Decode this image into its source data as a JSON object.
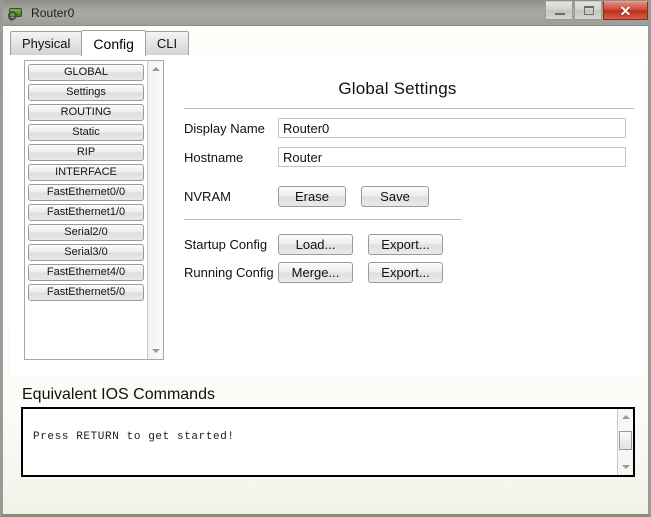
{
  "window": {
    "title": "Router0",
    "icon": "router-magnifier-icon",
    "controls": {
      "minimize_label": "",
      "maximize_label": "",
      "close_label": "✕"
    }
  },
  "tabs": [
    {
      "label": "Physical",
      "active": false
    },
    {
      "label": "Config",
      "active": true
    },
    {
      "label": "CLI",
      "active": false
    }
  ],
  "sidebar": {
    "items": [
      {
        "label": "GLOBAL"
      },
      {
        "label": "Settings"
      },
      {
        "label": "ROUTING"
      },
      {
        "label": "Static"
      },
      {
        "label": "RIP"
      },
      {
        "label": "INTERFACE"
      },
      {
        "label": "FastEthernet0/0"
      },
      {
        "label": "FastEthernet1/0"
      },
      {
        "label": "Serial2/0"
      },
      {
        "label": "Serial3/0"
      },
      {
        "label": "FastEthernet4/0"
      },
      {
        "label": "FastEthernet5/0"
      }
    ],
    "scroll_up_icon": "triangle-up-icon",
    "scroll_down_icon": "triangle-down-icon"
  },
  "settings": {
    "title": "Global Settings",
    "display_name": {
      "label": "Display Name",
      "value": "Router0"
    },
    "hostname": {
      "label": "Hostname",
      "value": "Router"
    },
    "nvram": {
      "label": "NVRAM",
      "erase_label": "Erase",
      "save_label": "Save"
    },
    "startup_config": {
      "label": "Startup Config",
      "load_label": "Load...",
      "export_label": "Export..."
    },
    "running_config": {
      "label": "Running Config",
      "merge_label": "Merge...",
      "export_label": "Export..."
    }
  },
  "ios": {
    "title": "Equivalent IOS Commands",
    "text": "Press RETURN to get started!",
    "scroll_up_icon": "triangle-up-icon",
    "scroll_down_icon": "triangle-down-icon"
  },
  "colors": {
    "close_button": "#b9301d",
    "titlebar": "#a4a49f",
    "panel_border": "#a8a8a8"
  }
}
